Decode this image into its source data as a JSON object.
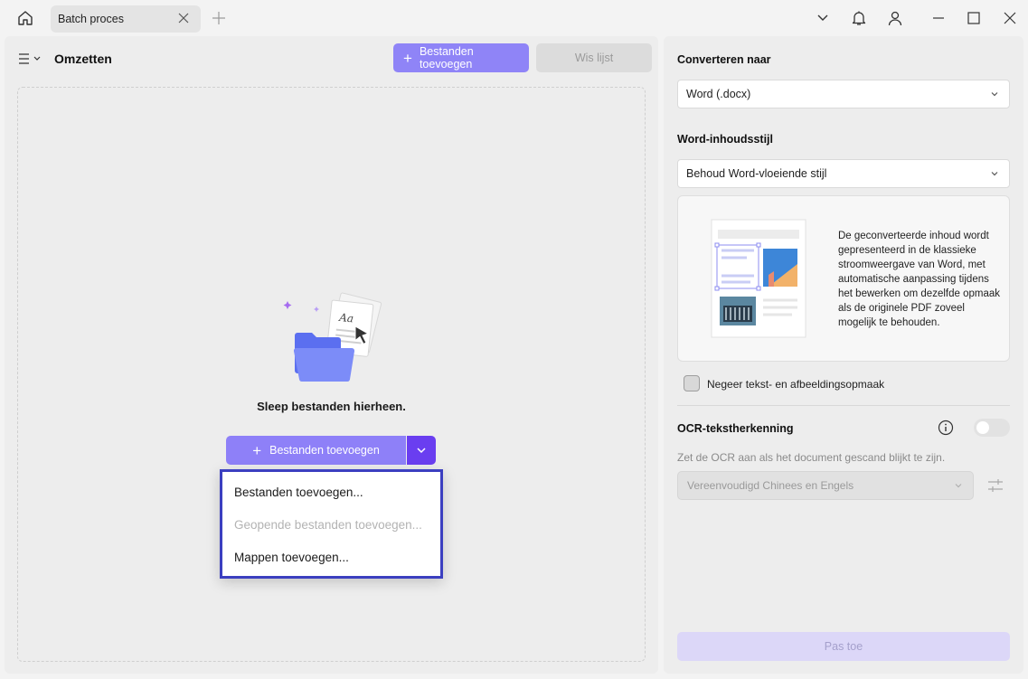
{
  "titlebar": {
    "tab_title": "Batch proces"
  },
  "left": {
    "title": "Omzetten",
    "add_files_button": "Bestanden toevoegen",
    "clear_list_button": "Wis lijst",
    "drop_text": "Sleep bestanden hierheen.",
    "add_files_main": "Bestanden toevoegen",
    "dropdown": {
      "items": [
        {
          "label": "Bestanden toevoegen...",
          "enabled": true
        },
        {
          "label": "Geopende bestanden toevoegen...",
          "enabled": false
        },
        {
          "label": "Mappen toevoegen...",
          "enabled": true
        }
      ]
    }
  },
  "right": {
    "convert_to_label": "Converteren naar",
    "convert_to_value": "Word (.docx)",
    "style_label": "Word-inhoudsstijl",
    "style_value": "Behoud Word-vloeiende stijl",
    "style_description": "De geconverteerde inhoud wordt gepresenteerd in de klassieke stroomweergave van Word, met automatische aanpassing tijdens het bewerken om dezelfde opmaak als de originele PDF zoveel mogelijk te behouden.",
    "ignore_format_label": "Negeer tekst- en afbeeldingsopmaak",
    "ignore_format_checked": false,
    "ocr_label": "OCR-tekstherkenning",
    "ocr_enabled": false,
    "ocr_hint": "Zet de OCR aan als het document gescand blijkt te zijn.",
    "ocr_language": "Vereenvoudigd Chinees en Engels",
    "apply_button": "Pas toe"
  },
  "colors": {
    "accent": "#8e80f8",
    "accent_dark": "#6a3ef0",
    "highlight_border": "#3b3fc0"
  },
  "icons": [
    "home-icon",
    "close-icon",
    "plus-icon",
    "chevron-down-icon",
    "bell-icon",
    "user-icon",
    "minimize-icon",
    "maximize-icon",
    "menu-icon",
    "info-icon",
    "sliders-icon"
  ]
}
